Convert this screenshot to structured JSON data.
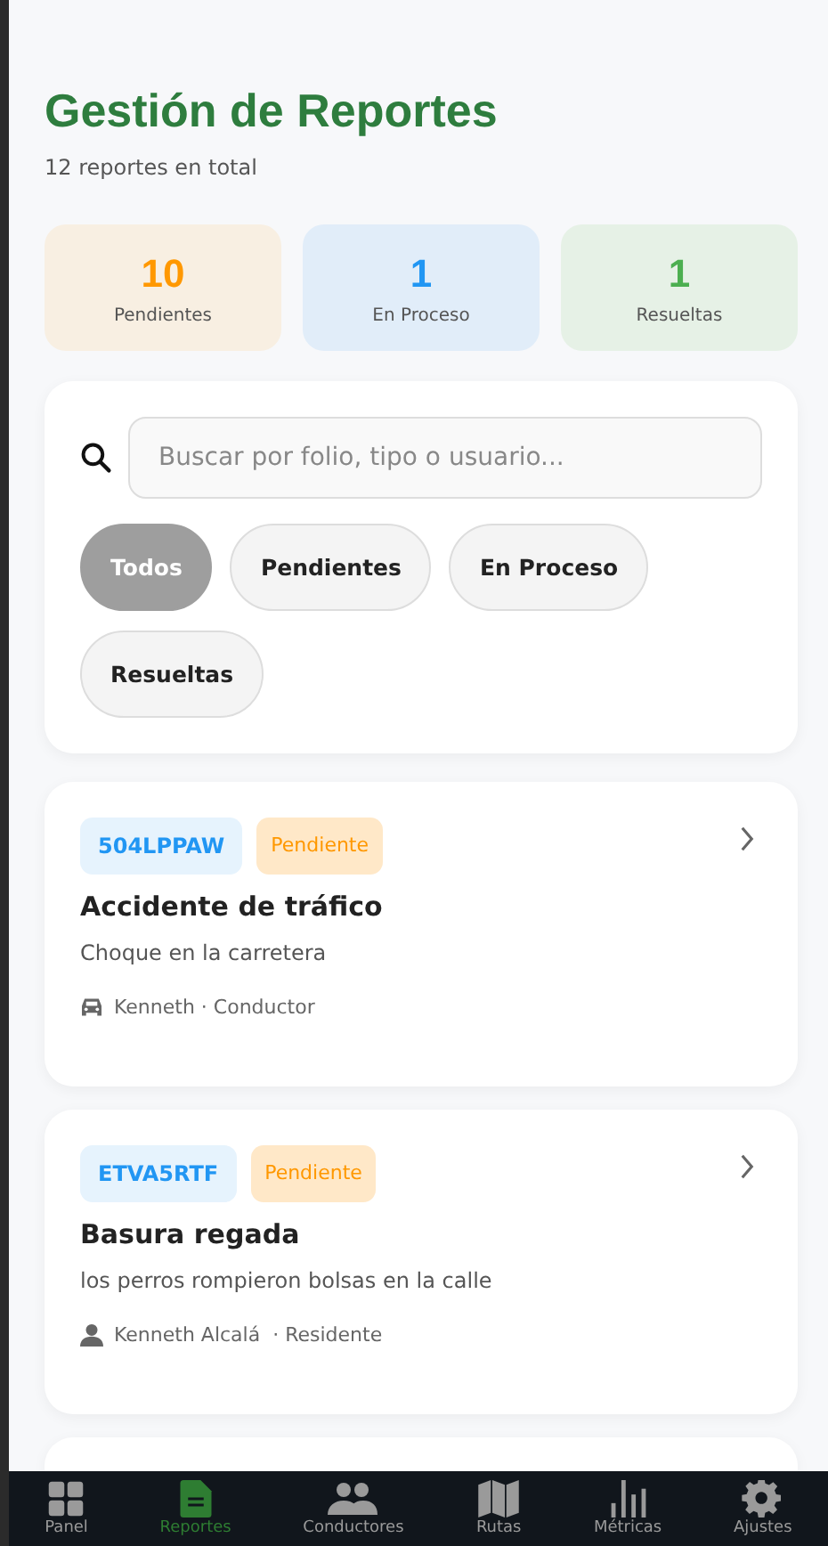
{
  "header": {
    "title": "Gestión de Reportes",
    "subtitle": "12 reportes en total"
  },
  "stats": [
    {
      "value": "10",
      "label": "Pendientes",
      "kind": "pending"
    },
    {
      "value": "1",
      "label": "En Proceso",
      "kind": "progress"
    },
    {
      "value": "1",
      "label": "Resueltas",
      "kind": "resolved"
    }
  ],
  "search": {
    "placeholder": "Buscar por folio, tipo o usuario..."
  },
  "filters": [
    {
      "label": "Todos",
      "selected": true
    },
    {
      "label": "Pendientes",
      "selected": false
    },
    {
      "label": "En Proceso",
      "selected": false
    },
    {
      "label": "Resueltas",
      "selected": false
    }
  ],
  "reports": [
    {
      "code": "504LPPAW",
      "status": {
        "label": "Pendiente",
        "kind": "pending"
      },
      "title": "Accidente de tráfico",
      "description": "Choque en la carretera",
      "user": {
        "text": "Kenneth · Conductor",
        "kind": "driver"
      }
    },
    {
      "code": "ETVA5RTF",
      "status": {
        "label": "Pendiente",
        "kind": "pending"
      },
      "title": "Basura regada",
      "description": "los perros rompieron bolsas en la calle",
      "user": {
        "text": "Kenneth Alcalá  · Residente",
        "kind": "resident"
      }
    }
  ],
  "nav": [
    {
      "label": "Panel",
      "kind": "grid",
      "selected": false
    },
    {
      "label": "Reportes",
      "kind": "document",
      "selected": true
    },
    {
      "label": "Conductores",
      "kind": "people",
      "selected": false
    },
    {
      "label": "Rutas",
      "kind": "map",
      "selected": false
    },
    {
      "label": "Métricas",
      "kind": "bars",
      "selected": false
    },
    {
      "label": "Ajustes",
      "kind": "gear",
      "selected": false
    }
  ]
}
